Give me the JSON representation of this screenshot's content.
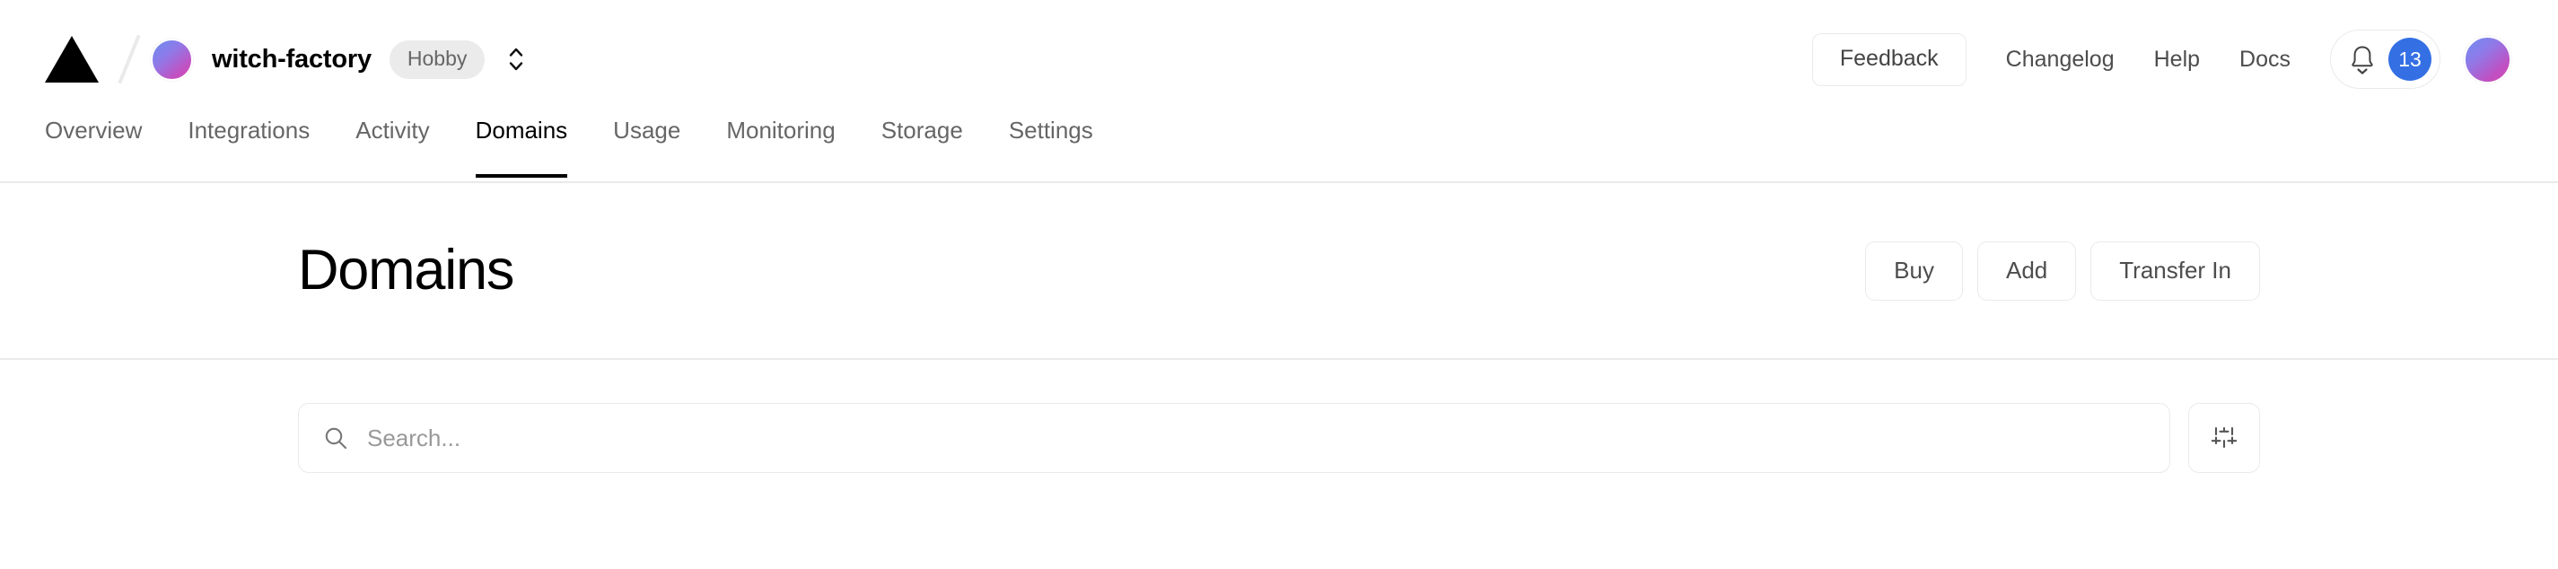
{
  "header": {
    "logo_icon": "vercel-triangle-logo",
    "separator": "/",
    "team_avatar_icon": "team-avatar-gradient",
    "team_name": "witch-factory",
    "plan_badge": "Hobby",
    "scope_selector_icon": "chevron-up-down-icon",
    "feedback_label": "Feedback",
    "links": [
      {
        "label": "Changelog",
        "name": "changelog-link"
      },
      {
        "label": "Help",
        "name": "help-link"
      },
      {
        "label": "Docs",
        "name": "docs-link"
      }
    ],
    "notifications": {
      "bell_icon": "bell-icon",
      "count": "13",
      "badge_color": "#3470e4"
    },
    "user_avatar_icon": "user-avatar-gradient"
  },
  "nav": {
    "tabs": [
      {
        "label": "Overview",
        "active": false
      },
      {
        "label": "Integrations",
        "active": false
      },
      {
        "label": "Activity",
        "active": false
      },
      {
        "label": "Domains",
        "active": true
      },
      {
        "label": "Usage",
        "active": false
      },
      {
        "label": "Monitoring",
        "active": false
      },
      {
        "label": "Storage",
        "active": false
      },
      {
        "label": "Settings",
        "active": false
      }
    ]
  },
  "main": {
    "page_title": "Domains",
    "actions": [
      {
        "label": "Buy",
        "name": "buy-button"
      },
      {
        "label": "Add",
        "name": "add-button"
      },
      {
        "label": "Transfer In",
        "name": "transfer-in-button"
      }
    ],
    "search": {
      "placeholder": "Search...",
      "value": "",
      "icon": "search-icon"
    },
    "filter": {
      "icon": "sliders-filter-icon"
    }
  },
  "colors": {
    "accent_blue": "#3470e4",
    "border": "#eaeaea",
    "text_primary": "#000000",
    "text_secondary": "#666666"
  }
}
